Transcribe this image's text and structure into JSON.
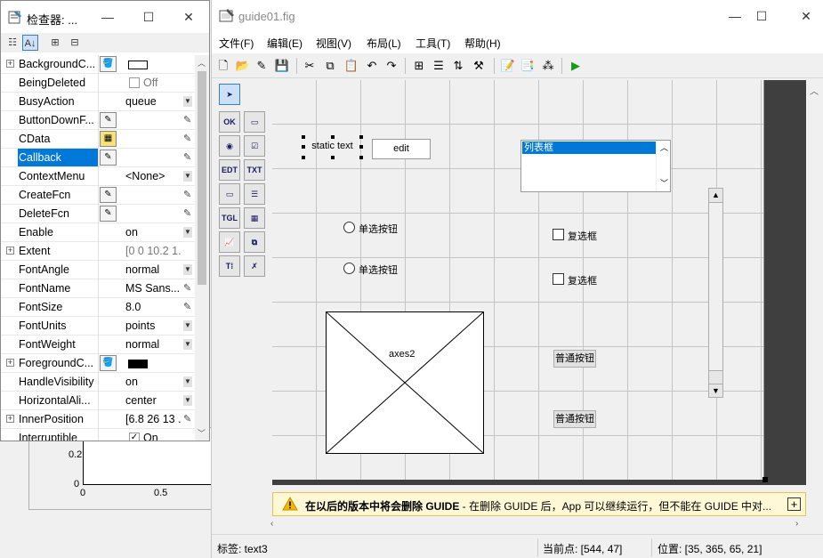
{
  "background_figure": {
    "y_ticks": [
      "0.2",
      "0"
    ],
    "x_ticks": [
      "0",
      "0.5"
    ]
  },
  "inspector": {
    "title": "检查器: ...",
    "window_controls": {
      "minimize": "—",
      "maximize": "☐",
      "close": "✕"
    },
    "rows": [
      {
        "name": "BackgroundC...",
        "expand": true,
        "icon": "paint-bucket-icon",
        "swatch": "#ffffff",
        "value": "",
        "control": "none"
      },
      {
        "name": "BeingDeleted",
        "checkbox": true,
        "checked": false,
        "value": "Off",
        "grey": true,
        "control": "none"
      },
      {
        "name": "BusyAction",
        "value": "queue",
        "control": "dropdown"
      },
      {
        "name": "ButtonDownF...",
        "icon": "callback-icon",
        "value": "",
        "control": "pencil"
      },
      {
        "name": "CData",
        "icon": "grid-icon",
        "value": "",
        "control": "pencil"
      },
      {
        "name": "Callback",
        "selected": true,
        "icon": "callback-icon",
        "value": "",
        "control": "pencil"
      },
      {
        "name": "ContextMenu",
        "value": "<None>",
        "control": "dropdown"
      },
      {
        "name": "CreateFcn",
        "icon": "callback-icon",
        "value": "",
        "control": "pencil"
      },
      {
        "name": "DeleteFcn",
        "icon": "callback-icon",
        "value": "",
        "control": "pencil"
      },
      {
        "name": "Enable",
        "value": "on",
        "control": "dropdown"
      },
      {
        "name": "Extent",
        "expand": true,
        "value": "[0 0 10.2 1....",
        "grey": true,
        "control": "none"
      },
      {
        "name": "FontAngle",
        "value": "normal",
        "control": "dropdown"
      },
      {
        "name": "FontName",
        "value": "MS Sans...",
        "control": "pencil"
      },
      {
        "name": "FontSize",
        "value": "8.0",
        "control": "pencil"
      },
      {
        "name": "FontUnits",
        "value": "points",
        "control": "dropdown"
      },
      {
        "name": "FontWeight",
        "value": "normal",
        "control": "dropdown"
      },
      {
        "name": "ForegroundC...",
        "expand": true,
        "icon": "paint-bucket-icon",
        "swatch": "#000000",
        "value": "",
        "control": "none"
      },
      {
        "name": "HandleVisibility",
        "value": "on",
        "control": "dropdown"
      },
      {
        "name": "HorizontalAli...",
        "value": "center",
        "control": "dropdown"
      },
      {
        "name": "InnerPosition",
        "expand": true,
        "value": "[6.8 26 13 ...",
        "control": "pencil"
      },
      {
        "name": "Interruptible",
        "checkbox": true,
        "checked": true,
        "value": "On",
        "control": "none"
      }
    ]
  },
  "guide": {
    "title": "guide01.fig",
    "window_controls": {
      "minimize": "—",
      "maximize": "☐",
      "close": "✕"
    },
    "menu": [
      "文件(F)",
      "编辑(E)",
      "视图(V)",
      "布局(L)",
      "工具(T)",
      "帮助(H)"
    ],
    "toolbar": [
      {
        "name": "new-icon",
        "glyph": "🗋"
      },
      {
        "name": "open-icon",
        "glyph": "📂"
      },
      {
        "name": "open-editor-icon",
        "glyph": "✎"
      },
      {
        "name": "save-icon",
        "glyph": "💾"
      },
      {
        "name": "cut-icon",
        "glyph": "✂"
      },
      {
        "name": "copy-icon",
        "glyph": "⧉"
      },
      {
        "name": "paste-icon",
        "glyph": "📋"
      },
      {
        "name": "undo-icon",
        "glyph": "↶"
      },
      {
        "name": "redo-icon",
        "glyph": "↷"
      },
      {
        "name": "align-icon",
        "glyph": "⊞"
      },
      {
        "name": "menu-editor-icon",
        "glyph": "☰"
      },
      {
        "name": "tab-order-icon",
        "glyph": "⇅"
      },
      {
        "name": "toolbar-editor-icon",
        "glyph": "⚒"
      },
      {
        "name": "m-file-editor-icon",
        "glyph": "📝"
      },
      {
        "name": "property-inspector-icon",
        "glyph": "📑"
      },
      {
        "name": "object-browser-icon",
        "glyph": "⁂"
      },
      {
        "name": "run-icon",
        "glyph": "▶"
      }
    ],
    "palette": [
      {
        "name": "select-tool",
        "glyph": "➤",
        "selected": true
      },
      {
        "name": "pushbutton-tool",
        "glyph": "OK"
      },
      {
        "name": "slider-tool",
        "glyph": "▭"
      },
      {
        "name": "radiobutton-tool",
        "glyph": "◉"
      },
      {
        "name": "checkbox-tool",
        "glyph": "☑"
      },
      {
        "name": "edit-text-tool",
        "glyph": "EDT"
      },
      {
        "name": "static-text-tool",
        "glyph": "TXT"
      },
      {
        "name": "popup-menu-tool",
        "glyph": "▭"
      },
      {
        "name": "listbox-tool",
        "glyph": "☰"
      },
      {
        "name": "toggle-button-tool",
        "glyph": "TGL"
      },
      {
        "name": "table-tool",
        "glyph": "▦"
      },
      {
        "name": "axes-tool",
        "glyph": "📈"
      },
      {
        "name": "panel-tool",
        "glyph": "⧉"
      },
      {
        "name": "button-group-tool",
        "glyph": "T⁞"
      },
      {
        "name": "activex-tool",
        "glyph": "✗"
      }
    ],
    "components": {
      "static_text": "static text",
      "edit": "edit",
      "listbox_item": "列表框",
      "radio1": "单选按钮",
      "radio2": "单选按钮",
      "check1": "复选框",
      "check2": "复选框",
      "axes": "axes2",
      "button1": "普通按钮",
      "button2": "普通按钮"
    },
    "warning": {
      "bold": "在以后的版本中将会删除 GUIDE",
      "text": " - 在删除 GUIDE 后，App 可以继续运行，但不能在 GUIDE 中对..."
    },
    "status": {
      "tag": "标签: text3",
      "current_point": "当前点:  [544, 47]",
      "position": "位置:  [35, 365, 65, 21]"
    }
  }
}
